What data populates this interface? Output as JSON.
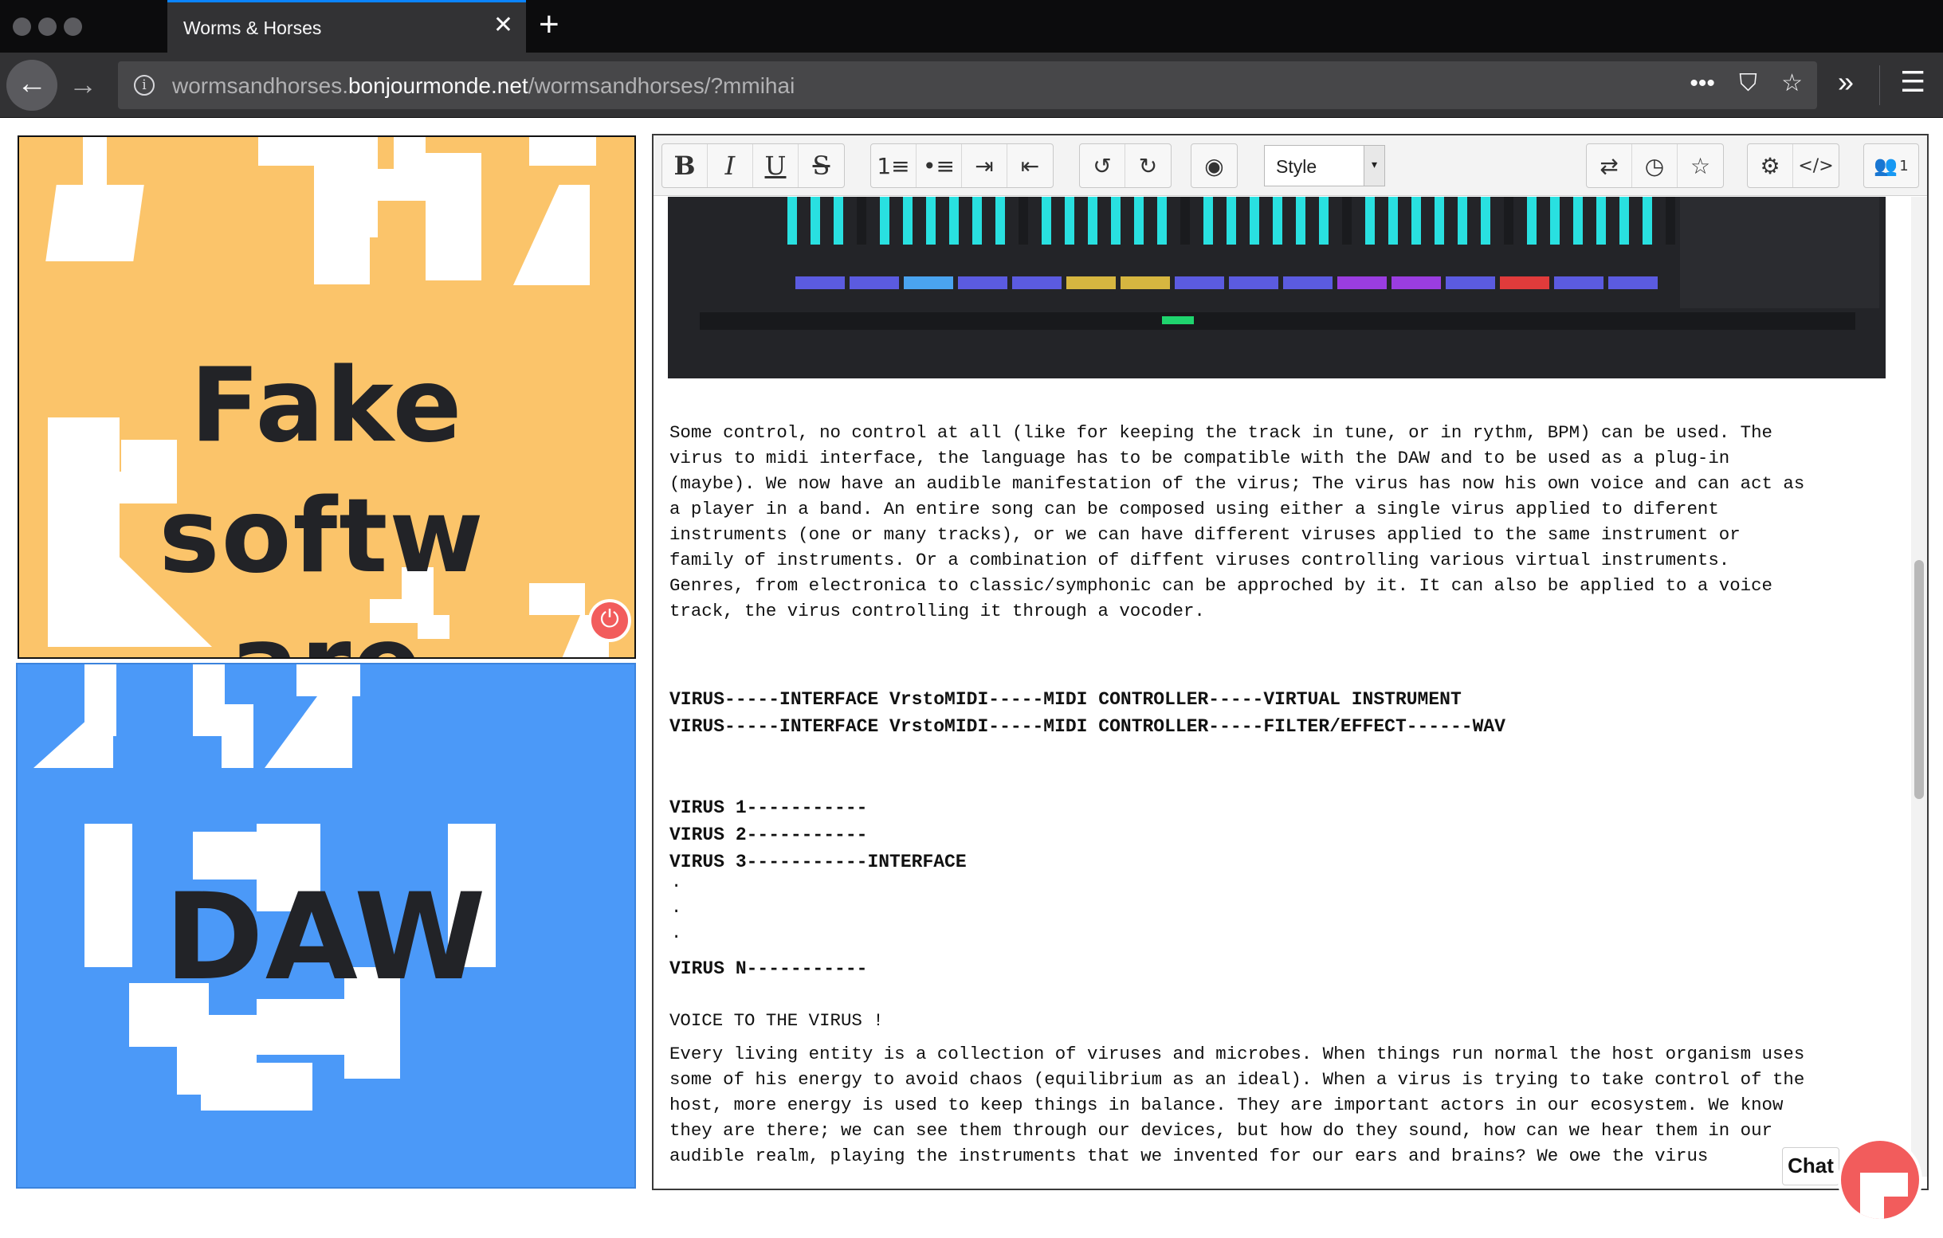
{
  "browser": {
    "tab_title": "Worms & Horses",
    "tab_close": "✕",
    "new_tab": "+",
    "url_prefix": "wormsandhorses.",
    "url_domain": "bonjourmonde.net",
    "url_path": "/wormsandhorses/?mmihai",
    "icons": {
      "back": "←",
      "forward": "→",
      "info": "i",
      "more": "•••",
      "pocket": "⛉",
      "bookmark": "☆",
      "overflow": "»",
      "menu": "☰"
    }
  },
  "tiles": {
    "fake": {
      "line1": "Fake",
      "line2": "softw",
      "line3": "are",
      "background": "#fbc46a"
    },
    "daw": {
      "label": "DAW",
      "background": "#4b99f8"
    }
  },
  "toolbar": {
    "bold": "B",
    "italic": "I",
    "underline": "U",
    "strike": "S",
    "ordered_list": "1≡",
    "bullet_list": "•≡",
    "indent": "⇥",
    "outdent": "⇤",
    "undo": "↺",
    "redo": "↻",
    "hide": "◉",
    "style_label": "Style",
    "style_arrow": "▾",
    "swap": "⇄",
    "history": "◷",
    "star": "☆",
    "settings": "⚙",
    "code": "</>",
    "users": "👥",
    "users_count": "1"
  },
  "content": {
    "para1": "Some control, no control at all (like for keeping the track in tune, or in rythm, BPM) can be used. The\nvirus to midi interface, the language has to be compatible with the DAW and to be used as a plug-in\n(maybe). We now have an audible manifestation of the virus; The virus has now his own voice and can act as\na player in a band. An entire song can be composed using either a single virus applied to diferent\ninstruments (one or many tracks), or we can have different viruses applied to the same instrument or\nfamily of instruments. Or a combination of diffent viruses controlling various virtual instruments.\nGenres, from electronica to classic/symphonic can be approched by it. It can also be applied to a voice\ntrack, the virus controlling it through a vocoder.",
    "chain1": "VIRUS-----INTERFACE VrstoMIDI-----MIDI CONTROLLER-----VIRTUAL INSTRUMENT",
    "chain2": "VIRUS-----INTERFACE VrstoMIDI-----MIDI CONTROLLER-----FILTER/EFFECT------WAV",
    "virus1": "VIRUS 1-----------",
    "virus2": "VIRUS 2-----------",
    "virus3": "VIRUS 3-----------INTERFACE",
    "dot": ".",
    "virusN": "VIRUS N-----------",
    "voice_heading": "VOICE TO THE VIRUS !",
    "para2": "Every living entity is a collection of viruses and microbes. When things run normal the host organism uses\nsome of his energy to avoid chaos (equilibrium as an ideal). When a virus is trying to take control of the\nhost, more energy is used to keep things in balance. They are important actors in our ecosystem. We know\nthey are there; we can see them through our devices, but how do they sound, how can we hear them in our\naudible realm, playing the instruments that we invented for our ears and brains? We owe the virus"
  },
  "chat": {
    "label": "Chat"
  }
}
